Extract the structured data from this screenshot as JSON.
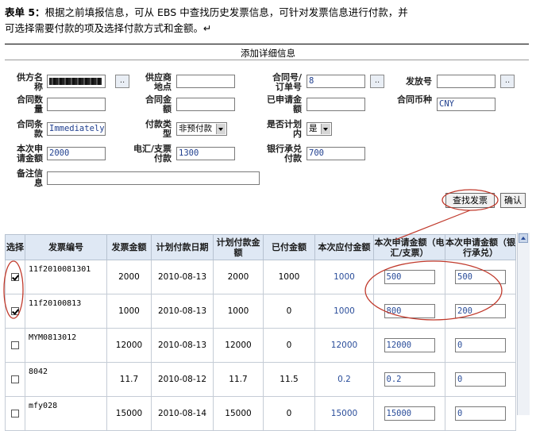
{
  "intro": {
    "bold": "表单 5：",
    "line1": "根据之前填报信息，可从 EBS 中查找历史发票信息，可针对发票信息进行付款，并",
    "line2": "可选择需要付款的项及选择付款方式和金额。↵"
  },
  "form": {
    "title": "添加详细信息",
    "supplier_name_label": "供方名称",
    "supply_location_label": "供应商地点",
    "contract_no_label": "合同号/订单号",
    "contract_no_value": "8",
    "release_no_label": "发放号",
    "contract_qty_label": "合同数量",
    "contract_amount_label": "合同金额",
    "requested_amount_label": "已申请金额",
    "currency_label": "合同币种",
    "currency_value": "CNY",
    "terms_label": "合同条款",
    "terms_value": "Immediately",
    "payment_type_label": "付款类型",
    "payment_type_value": "非预付款",
    "planned_label": "是否计划内",
    "planned_value": "是",
    "current_request_label": "本次申请金额",
    "current_request_value": "2000",
    "wire_label": "电汇/支票付款",
    "wire_value": "1300",
    "bank_label": "银行承兑付款",
    "bank_value": "700",
    "remark_label": "备注信息",
    "lov_button": "..",
    "find_button": "查找发票",
    "confirm_button": "确认"
  },
  "table": {
    "headers": [
      "选择",
      "发票编号",
      "发票金额",
      "计划付款日期",
      "计划付款金额",
      "已付金额",
      "本次应付金额",
      "本次申请金额（电汇/支票）",
      "本次申请金额（银行承兑）"
    ],
    "rows": [
      {
        "checked": true,
        "invoice": "11f2010081301",
        "amount": "2000",
        "date": "2010-08-13",
        "planned": "2000",
        "paid": "1000",
        "due": "1000",
        "wire": "500",
        "bank": "500"
      },
      {
        "checked": true,
        "invoice": "11f20100813",
        "amount": "1000",
        "date": "2010-08-13",
        "planned": "1000",
        "paid": "0",
        "due": "1000",
        "wire": "800",
        "bank": "200"
      },
      {
        "checked": false,
        "invoice": "MYM0813012",
        "amount": "12000",
        "date": "2010-08-13",
        "planned": "12000",
        "paid": "0",
        "due": "12000",
        "wire": "12000",
        "bank": "0"
      },
      {
        "checked": false,
        "invoice": "8042",
        "amount": "11.7",
        "date": "2010-08-12",
        "planned": "11.7",
        "paid": "11.5",
        "due": "0.2",
        "wire": "0.2",
        "bank": "0"
      },
      {
        "checked": false,
        "invoice": "mfy028",
        "amount": "15000",
        "date": "2010-08-14",
        "planned": "15000",
        "paid": "0",
        "due": "15000",
        "wire": "15000",
        "bank": "0"
      }
    ]
  },
  "colors": {
    "annotation": "#c0392b",
    "header_bg": "#dfe8f4",
    "value_text": "#2a4d9a"
  }
}
